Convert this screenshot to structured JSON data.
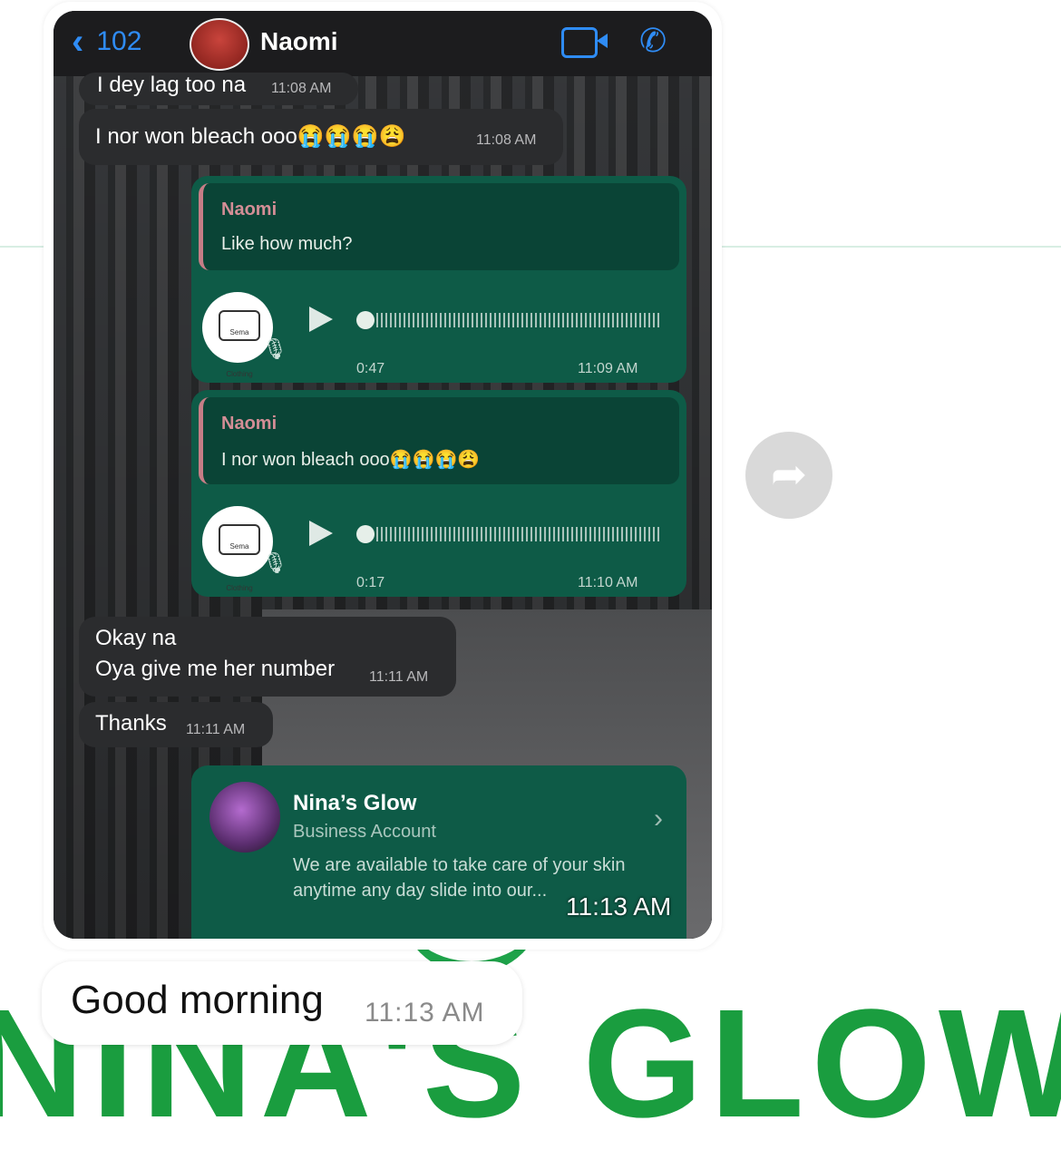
{
  "header": {
    "back_count": "102",
    "contact_name": "Naomi"
  },
  "messages": {
    "m1": {
      "text": "I dey lag too na",
      "time": "11:08 AM"
    },
    "m2": {
      "text": "I nor won bleach ooo😭😭😭😩",
      "time": "11:08 AM"
    },
    "voice1": {
      "quote_name": "Naomi",
      "quote_text": "Like how much?",
      "duration": "0:47",
      "time": "11:09 AM"
    },
    "voice2": {
      "quote_name": "Naomi",
      "quote_text": "I nor won bleach ooo😭😭😭😩",
      "duration": "0:17",
      "time": "11:10 AM"
    },
    "m3": {
      "line1": "Okay na",
      "line2": "Oya give me her number",
      "time": "11:11 AM"
    },
    "m4": {
      "text": "Thanks",
      "time": "11:11 AM"
    },
    "business": {
      "name": "Nina’s Glow",
      "type": "Business Account",
      "description": "We are available to take care of your skin anytime any day slide into our..."
    },
    "overlay_time": "11:13 AM"
  },
  "voice_logo_text": "Sema Clothing",
  "outer_message": {
    "text": "Good morning",
    "time": "11:13 AM"
  },
  "colors": {
    "accent": "#2f8cf5",
    "outgoing_bubble": "#0e5b47",
    "incoming_bubble": "#2b2c2e",
    "brand_green": "#1a9d3f"
  },
  "icons": [
    "chevron-left-icon",
    "video-call-icon",
    "phone-icon",
    "play-icon",
    "mic-icon",
    "chevron-right-icon",
    "forward-icon"
  ]
}
